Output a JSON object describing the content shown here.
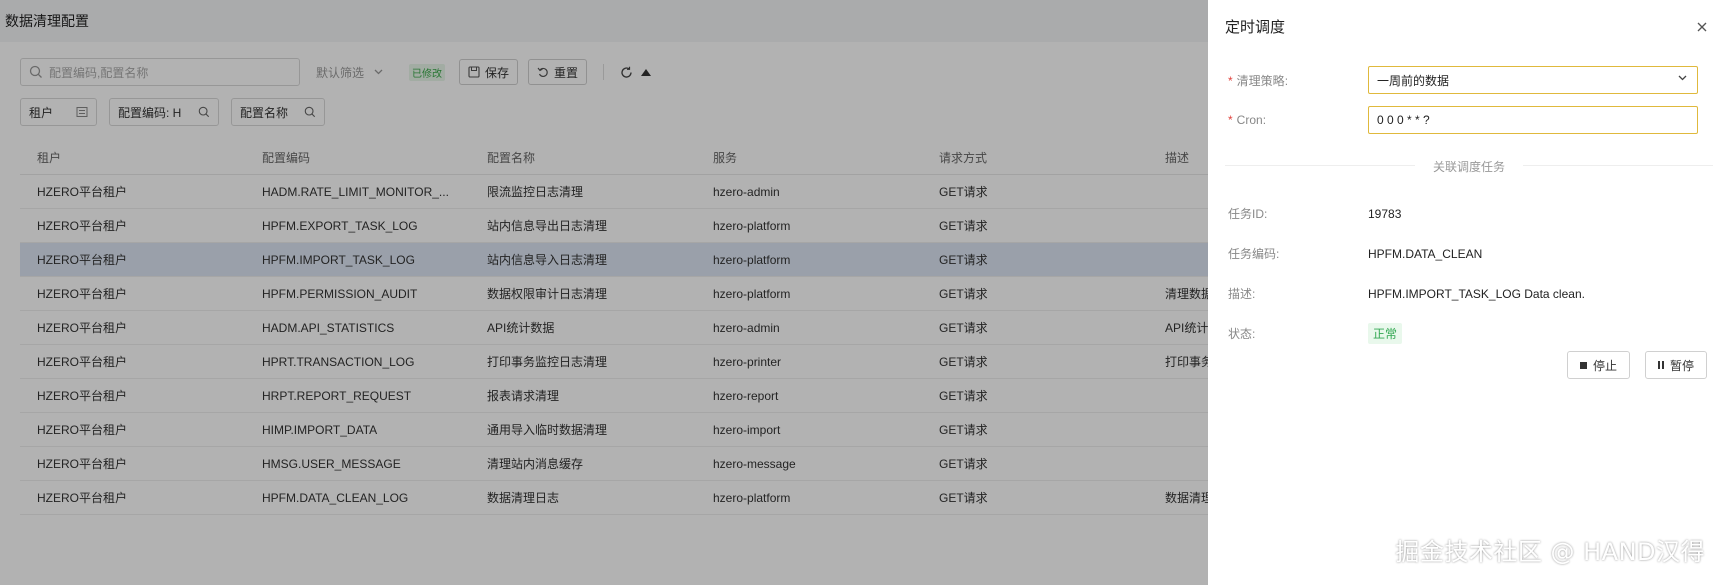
{
  "page": {
    "title": "数据清理配置",
    "search": {
      "placeholder": "配置编码,配置名称"
    },
    "filter_select": "默认筛选",
    "modified_tag": "已修改",
    "save_label": "保存",
    "reset_label": "重置",
    "filters": [
      {
        "label": "租户"
      },
      {
        "label": "配置编码: H"
      },
      {
        "label": "配置名称"
      }
    ]
  },
  "table": {
    "headers": [
      "租户",
      "配置编码",
      "配置名称",
      "服务",
      "请求方式",
      "描述"
    ],
    "rows": [
      {
        "tenant": "HZERO平台租户",
        "code": "HADM.RATE_LIMIT_MONITOR_...",
        "name": "限流监控日志清理",
        "service": "hzero-admin",
        "method": "GET请求",
        "desc": ""
      },
      {
        "tenant": "HZERO平台租户",
        "code": "HPFM.EXPORT_TASK_LOG",
        "name": "站内信息导出日志清理",
        "service": "hzero-platform",
        "method": "GET请求",
        "desc": ""
      },
      {
        "tenant": "HZERO平台租户",
        "code": "HPFM.IMPORT_TASK_LOG",
        "name": "站内信息导入日志清理",
        "service": "hzero-platform",
        "method": "GET请求",
        "desc": ""
      },
      {
        "tenant": "HZERO平台租户",
        "code": "HPFM.PERMISSION_AUDIT",
        "name": "数据权限审计日志清理",
        "service": "hzero-platform",
        "method": "GET请求",
        "desc": "清理数据"
      },
      {
        "tenant": "HZERO平台租户",
        "code": "HADM.API_STATISTICS",
        "name": "API统计数据",
        "service": "hzero-admin",
        "method": "GET请求",
        "desc": "API统计"
      },
      {
        "tenant": "HZERO平台租户",
        "code": "HPRT.TRANSACTION_LOG",
        "name": "打印事务监控日志清理",
        "service": "hzero-printer",
        "method": "GET请求",
        "desc": "打印事务"
      },
      {
        "tenant": "HZERO平台租户",
        "code": "HRPT.REPORT_REQUEST",
        "name": "报表请求清理",
        "service": "hzero-report",
        "method": "GET请求",
        "desc": ""
      },
      {
        "tenant": "HZERO平台租户",
        "code": "HIMP.IMPORT_DATA",
        "name": "通用导入临时数据清理",
        "service": "hzero-import",
        "method": "GET请求",
        "desc": ""
      },
      {
        "tenant": "HZERO平台租户",
        "code": "HMSG.USER_MESSAGE",
        "name": "清理站内消息缓存",
        "service": "hzero-message",
        "method": "GET请求",
        "desc": ""
      },
      {
        "tenant": "HZERO平台租户",
        "code": "HPFM.DATA_CLEAN_LOG",
        "name": "数据清理日志",
        "service": "hzero-platform",
        "method": "GET请求",
        "desc": "数据清理"
      }
    ]
  },
  "drawer": {
    "title": "定时调度",
    "strategy_label": "清理策略",
    "strategy_value": "一周前的数据",
    "cron_label": "Cron",
    "cron_value": "0 0 0 * * ?",
    "section_title": "关联调度任务",
    "task_id_label": "任务ID",
    "task_id_value": "19783",
    "task_code_label": "任务编码",
    "task_code_value": "HPFM.DATA_CLEAN",
    "desc_label": "描述",
    "desc_value": "HPFM.IMPORT_TASK_LOG Data clean.",
    "status_label": "状态",
    "status_value": "正常",
    "stop_label": "停止",
    "pause_label": "暂停"
  },
  "watermark": "掘金技术社区 @ HAND汉得",
  "colors": {
    "required": "#e0433e",
    "focus_border": "#e0b93c",
    "status_green": "#34a853",
    "selected_row": "#dde6f4"
  }
}
